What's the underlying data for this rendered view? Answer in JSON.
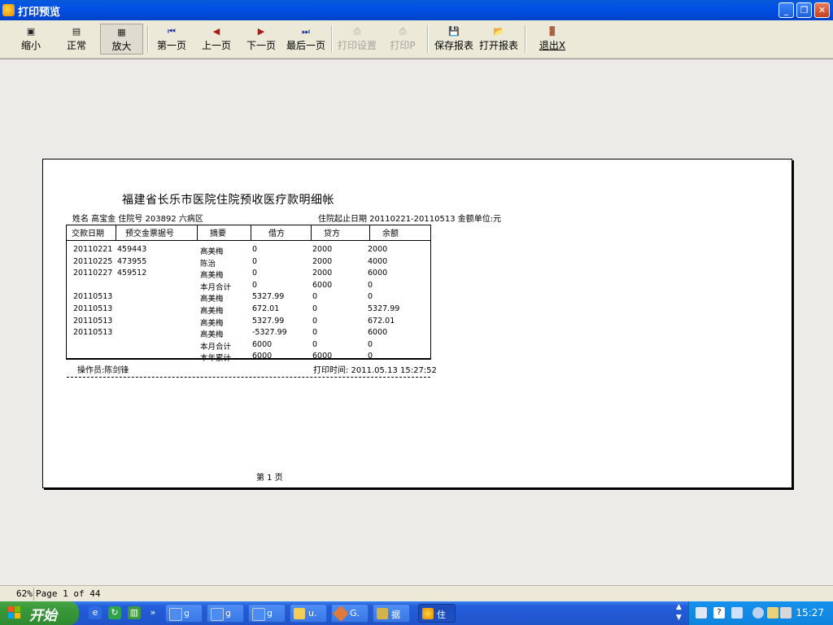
{
  "window": {
    "title": "打印预览"
  },
  "toolbar": {
    "zoom_out": "缩小",
    "normal": "正常",
    "zoom_in": "放大",
    "first_page": "第一页",
    "prev_page": "上一页",
    "next_page": "下一页",
    "last_page": "最后一页",
    "print_setup": "打印设置",
    "print": "打印P",
    "save_report": "保存报表",
    "open_report": "打开报表",
    "exit": "退出X"
  },
  "report": {
    "title": "福建省长乐市医院住院预收医疗款明细帐",
    "info_left": "姓名 高宝金 住院号 203892  六病区",
    "info_right": "住院起止日期 20110221-20110513 金额单位:元",
    "columns": [
      "交款日期",
      "预交金票据号",
      "摘要",
      "借方",
      "贷方",
      "余额"
    ],
    "rows": [
      [
        "20110221",
        "459443",
        "高美梅",
        "0",
        "2000",
        "2000"
      ],
      [
        "20110225",
        "473955",
        "陈治",
        "0",
        "2000",
        "4000"
      ],
      [
        "20110227",
        "459512",
        "高美梅",
        "0",
        "2000",
        "6000"
      ],
      [
        "",
        "",
        "本月合计",
        "0",
        "6000",
        "0"
      ],
      [
        "20110513",
        "",
        "高美梅",
        "5327.99",
        "0",
        "0"
      ],
      [
        "20110513",
        "",
        "高美梅",
        "672.01",
        "0",
        "5327.99"
      ],
      [
        "20110513",
        "",
        "高美梅",
        "5327.99",
        "0",
        "672.01"
      ],
      [
        "20110513",
        "",
        "高美梅",
        "-5327.99",
        "0",
        "6000"
      ],
      [
        "",
        "",
        "本月合计",
        "6000",
        "0",
        "0"
      ],
      [
        "",
        "",
        "本年累计",
        "6000",
        "6000",
        "0"
      ]
    ],
    "operator": "操作员:陈剑锋",
    "print_time": "打印时间: 2011.05.13 15:27:52",
    "page_label": "第 1 页"
  },
  "status": {
    "zoom": "62%",
    "page": "Page 1 of 44"
  },
  "taskbar": {
    "start": "开始",
    "tasks": [
      "g",
      "g",
      "g",
      "u.",
      "G.",
      "据",
      "住"
    ],
    "clock": "15:27"
  }
}
